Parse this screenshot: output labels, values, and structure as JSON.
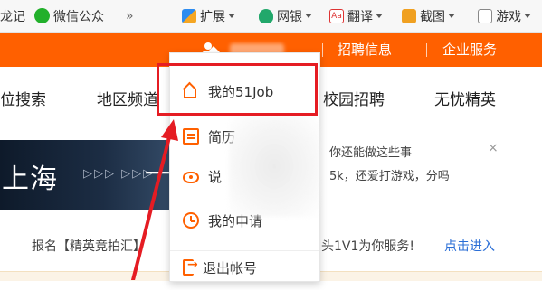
{
  "bookmarks": {
    "item1": "龙记",
    "item2": "微信公众",
    "overflow": "»",
    "extensions": [
      {
        "label": "扩展",
        "icon": "extensions-icon"
      },
      {
        "label": "网银",
        "icon": "bank-shield-icon"
      },
      {
        "label": "翻译",
        "icon": "translate-icon"
      },
      {
        "label": "截图",
        "icon": "screenshot-icon"
      },
      {
        "label": "游戏",
        "icon": "game-icon"
      }
    ]
  },
  "topbar": {
    "links": [
      "招聘信息",
      "企业服务"
    ]
  },
  "nav": {
    "items": [
      "位搜索",
      "地区频道",
      "校园招聘",
      "无忧精英"
    ]
  },
  "banner": {
    "text": "上海",
    "arrows": "▷▷▷ ▷▷▷",
    "dash": "一"
  },
  "notice": {
    "line1": "你还能做这些事",
    "line2": "5k，还爱打游戏，分吗",
    "close": "×"
  },
  "promo": {
    "left": "报名【精英竞拍汇】",
    "right": "头1V1为你服务!",
    "link": "点击进入"
  },
  "dropdown": {
    "items": [
      {
        "label": "我的51Job",
        "icon": "home-icon"
      },
      {
        "label": "简历",
        "icon": "resume-icon"
      },
      {
        "label": "说",
        "icon": "eye-icon"
      },
      {
        "label": "我的申请",
        "icon": "clock-icon"
      },
      {
        "label": "退出帐号",
        "icon": "logout-icon"
      }
    ]
  },
  "colors": {
    "brand": "#ff6000",
    "annotation": "#e51c23",
    "link": "#2a6ed6"
  }
}
